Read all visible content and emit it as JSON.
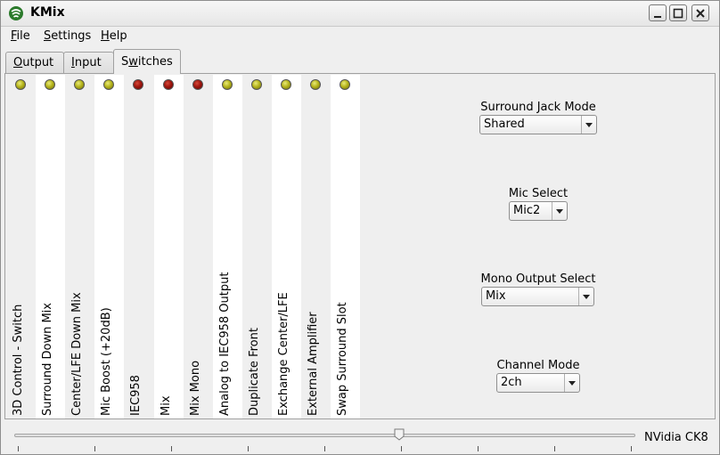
{
  "window": {
    "title": "KMix"
  },
  "menu": [
    {
      "label": "File",
      "mnemonic": "F",
      "rest": "ile"
    },
    {
      "label": "Settings",
      "mnemonic": "S",
      "rest": "ettings"
    },
    {
      "label": "Help",
      "mnemonic": "H",
      "rest": "elp"
    }
  ],
  "tabs": [
    {
      "label": "Output",
      "mnemonic": "O",
      "rest": "utput",
      "active": false
    },
    {
      "label": "Input",
      "mnemonic": "I",
      "rest": "nput",
      "active": false
    },
    {
      "label": "Switches",
      "pre": "S",
      "mnemonic": "w",
      "rest": "itches",
      "active": true
    }
  ],
  "switches": [
    {
      "label": "3D Control - Switch",
      "state": "yellow"
    },
    {
      "label": "Surround Down Mix",
      "state": "yellow"
    },
    {
      "label": "Center/LFE Down Mix",
      "state": "yellow"
    },
    {
      "label": "Mic Boost (+20dB)",
      "state": "yellow"
    },
    {
      "label": "IEC958",
      "state": "red"
    },
    {
      "label": "Mix",
      "state": "red"
    },
    {
      "label": "Mix Mono",
      "state": "red"
    },
    {
      "label": "Analog to IEC958 Output",
      "state": "yellow"
    },
    {
      "label": "Duplicate Front",
      "state": "yellow"
    },
    {
      "label": "Exchange Center/LFE",
      "state": "yellow"
    },
    {
      "label": "External Amplifier",
      "state": "yellow"
    },
    {
      "label": "Swap Surround Slot",
      "state": "yellow"
    }
  ],
  "enums": [
    {
      "label": "Surround Jack Mode",
      "value": "Shared"
    },
    {
      "label": "Mic Select",
      "value": "Mic2"
    },
    {
      "label": "Mono Output Select",
      "value": "Mix"
    },
    {
      "label": "Channel Mode",
      "value": "2ch"
    }
  ],
  "master": {
    "card_name": "NVidia CK8",
    "volume_fraction": 0.62
  },
  "colors": {
    "led_on": "#b6b51c",
    "led_red": "#a1160e"
  }
}
